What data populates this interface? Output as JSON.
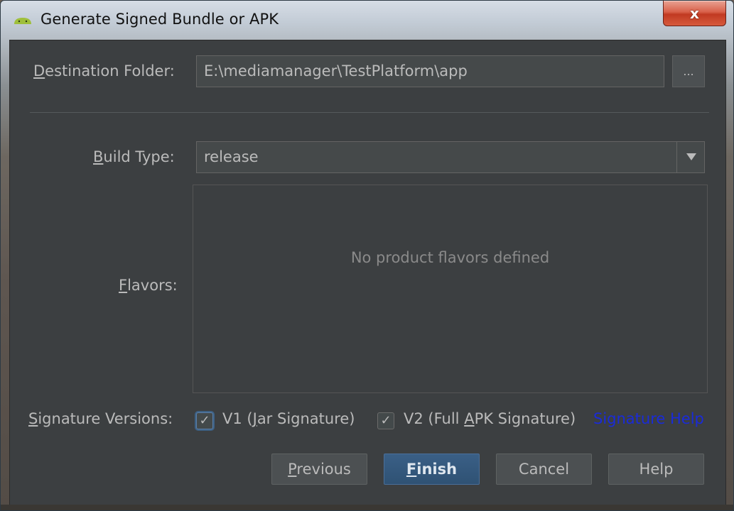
{
  "window": {
    "title": "Generate Signed Bundle or APK",
    "app_icon": "android-icon",
    "close_label": "x"
  },
  "destination": {
    "label": "Destination Folder:",
    "label_mnemonic": "D",
    "label_rest": "estination Folder:",
    "value": "E:\\mediamanager\\TestPlatform\\app",
    "browse_label": "..."
  },
  "build_type": {
    "label_mnemonic": "B",
    "label_rest": "uild Type:",
    "value": "release",
    "dropdown_icon": "chevron-down-icon"
  },
  "flavors": {
    "label_mnemonic": "F",
    "label_rest": "lavors:",
    "empty_text": "No product flavors defined"
  },
  "signature": {
    "label_mnemonic": "S",
    "label_rest": "ignature Versions:",
    "v1": {
      "checked": true,
      "prefix": "V1 (",
      "mnemonic": "J",
      "rest": "ar Signature)"
    },
    "v2": {
      "checked": true,
      "prefix": "V2 (Full ",
      "mnemonic": "A",
      "rest": "PK Signature)"
    },
    "help_link": "Signature Help"
  },
  "buttons": {
    "previous_mnemonic": "P",
    "previous_rest": "revious",
    "finish_mnemonic": "F",
    "finish_rest": "inish",
    "cancel": "Cancel",
    "help": "Help"
  },
  "colors": {
    "dialog_bg": "#3c3f41",
    "field_bg": "#45494a",
    "text": "#bbbbbb",
    "primary_button": "#365880",
    "link": "#1a2bd8",
    "close_button": "#c84a31"
  }
}
